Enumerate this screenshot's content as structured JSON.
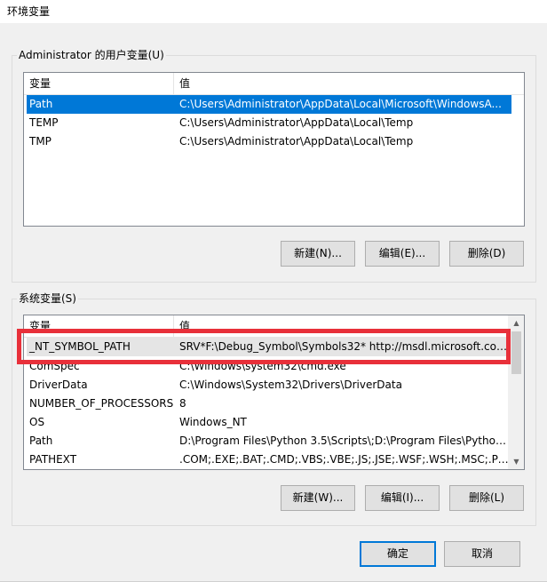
{
  "window": {
    "title": "环境变量"
  },
  "user_group": {
    "label": "Administrator 的用户变量(U)",
    "columns": [
      "变量",
      "值"
    ],
    "rows": [
      {
        "name": "Path",
        "value": "C:\\Users\\Administrator\\AppData\\Local\\Microsoft\\WindowsA...",
        "selected": true
      },
      {
        "name": "TEMP",
        "value": "C:\\Users\\Administrator\\AppData\\Local\\Temp",
        "selected": false
      },
      {
        "name": "TMP",
        "value": "C:\\Users\\Administrator\\AppData\\Local\\Temp",
        "selected": false
      }
    ],
    "buttons": {
      "new": "新建(N)...",
      "edit": "编辑(E)...",
      "delete": "删除(D)"
    }
  },
  "system_group": {
    "label": "系统变量(S)",
    "columns": [
      "变量",
      "值"
    ],
    "rows": [
      {
        "name": "_NT_SYMBOL_PATH",
        "value": "SRV*F:\\Debug_Symbol\\Symbols32* http://msdl.microsoft.com..."
      },
      {
        "name": "ComSpec",
        "value": "C:\\Windows\\system32\\cmd.exe"
      },
      {
        "name": "DriverData",
        "value": "C:\\Windows\\System32\\Drivers\\DriverData"
      },
      {
        "name": "NUMBER_OF_PROCESSORS",
        "value": "8"
      },
      {
        "name": "OS",
        "value": "Windows_NT"
      },
      {
        "name": "Path",
        "value": "D:\\Program Files\\Python 3.5\\Scripts\\;D:\\Program Files\\Python..."
      },
      {
        "name": "PATHEXT",
        "value": ".COM;.EXE;.BAT;.CMD;.VBS;.VBE;.JS;.JSE;.WSF;.WSH;.MSC;.PY;.P..."
      }
    ],
    "buttons": {
      "new": "新建(W)...",
      "edit": "编辑(I)...",
      "delete": "删除(L)"
    }
  },
  "footer": {
    "ok": "确定",
    "cancel": "取消"
  },
  "colors": {
    "selection": "#0078d7",
    "annotation": "#e8303a"
  }
}
